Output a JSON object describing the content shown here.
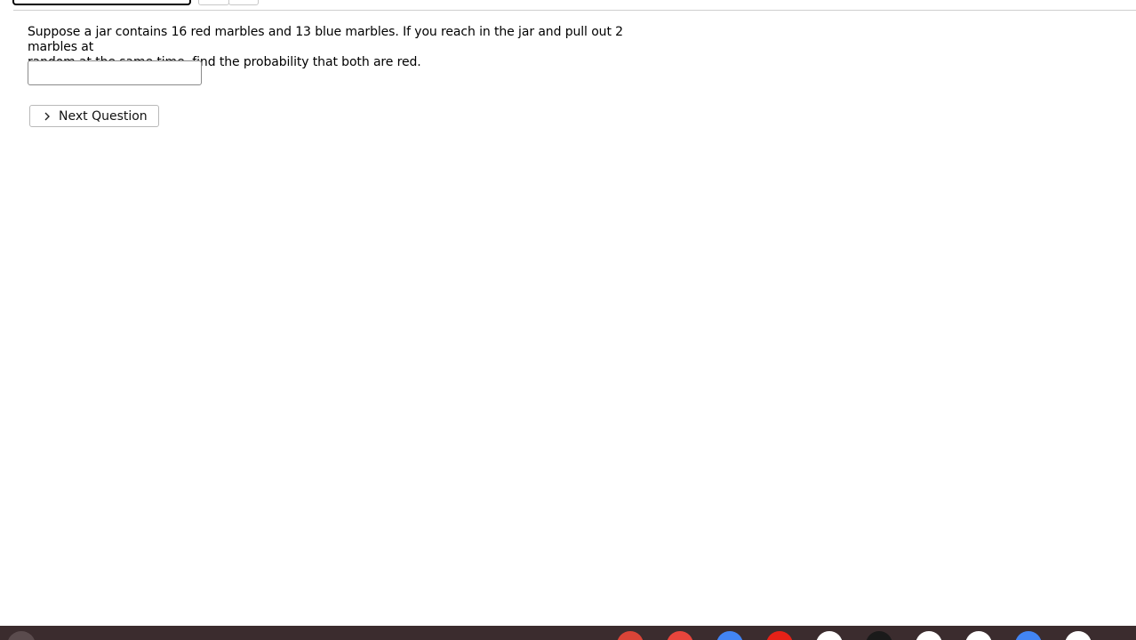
{
  "question": {
    "text_line1": "Suppose a jar contains 16 red marbles and 13 blue marbles. If you reach in the jar and pull out 2 marbles at",
    "text_line2": "random at the same time, find the probability that both are red."
  },
  "answer": {
    "value": "",
    "placeholder": ""
  },
  "next_button": {
    "label": "Next Question",
    "icon": "chevron-right-icon"
  },
  "taskbar": {
    "background": "#3b2c2e",
    "apps": [
      {
        "icon": "chrome-icon",
        "color": "#db4437"
      },
      {
        "icon": "gmail-icon",
        "color": "#e8453c"
      },
      {
        "icon": "docs-icon",
        "color": "#4285f4"
      },
      {
        "icon": "youtube-icon",
        "color": "#e62117"
      },
      {
        "icon": "play-store-icon",
        "color": "#ffffff"
      },
      {
        "icon": "app-icon",
        "color": "#1a1a1a"
      },
      {
        "icon": "app-icon",
        "color": "#ffffff"
      },
      {
        "icon": "app-icon",
        "color": "#ffffff"
      },
      {
        "icon": "app-icon",
        "color": "#4285f4"
      },
      {
        "icon": "sheets-icon",
        "color": "#ffffff"
      }
    ]
  }
}
